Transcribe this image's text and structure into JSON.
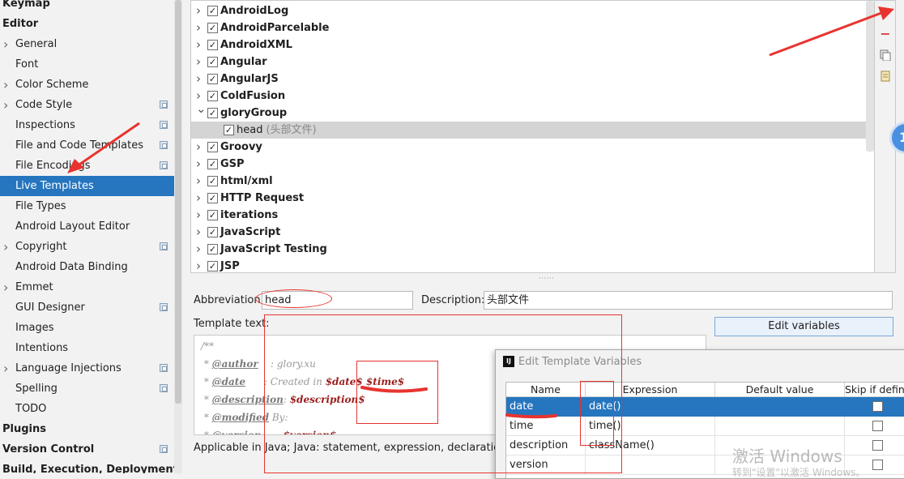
{
  "sidebar": {
    "items": [
      {
        "label": "Keymap",
        "level": 0
      },
      {
        "label": "Editor",
        "level": 0
      },
      {
        "label": "General",
        "level": 1,
        "expandable": true
      },
      {
        "label": "Font",
        "level": 1
      },
      {
        "label": "Color Scheme",
        "level": 1,
        "expandable": true
      },
      {
        "label": "Code Style",
        "level": 1,
        "expandable": true,
        "project": true
      },
      {
        "label": "Inspections",
        "level": 1,
        "project": true
      },
      {
        "label": "File and Code Templates",
        "level": 1,
        "project": true
      },
      {
        "label": "File Encodings",
        "level": 1,
        "project": true
      },
      {
        "label": "Live Templates",
        "level": 1,
        "selected": true
      },
      {
        "label": "File Types",
        "level": 1
      },
      {
        "label": "Android Layout Editor",
        "level": 1
      },
      {
        "label": "Copyright",
        "level": 1,
        "expandable": true,
        "project": true
      },
      {
        "label": "Android Data Binding",
        "level": 1
      },
      {
        "label": "Emmet",
        "level": 1,
        "expandable": true
      },
      {
        "label": "GUI Designer",
        "level": 1,
        "project": true
      },
      {
        "label": "Images",
        "level": 1
      },
      {
        "label": "Intentions",
        "level": 1
      },
      {
        "label": "Language Injections",
        "level": 1,
        "expandable": true,
        "project": true
      },
      {
        "label": "Spelling",
        "level": 1,
        "project": true
      },
      {
        "label": "TODO",
        "level": 1
      },
      {
        "label": "Plugins",
        "level": 0
      },
      {
        "label": "Version Control",
        "level": 0,
        "expandable": true,
        "project": true
      },
      {
        "label": "Build, Execution, Deployment",
        "level": 0,
        "expandable": true
      }
    ]
  },
  "templates": {
    "groups": [
      {
        "label": "AndroidLog",
        "checked": true,
        "expanded": false
      },
      {
        "label": "AndroidParcelable",
        "checked": true,
        "expanded": false
      },
      {
        "label": "AndroidXML",
        "checked": true,
        "expanded": false
      },
      {
        "label": "Angular",
        "checked": true,
        "expanded": false
      },
      {
        "label": "AngularJS",
        "checked": true,
        "expanded": false
      },
      {
        "label": "ColdFusion",
        "checked": true,
        "expanded": false
      },
      {
        "label": "gloryGroup",
        "checked": true,
        "expanded": true
      },
      {
        "label": "head",
        "checked": true,
        "child": true,
        "selected": true,
        "desc": "(头部文件)"
      },
      {
        "label": "Groovy",
        "checked": true,
        "expanded": false
      },
      {
        "label": "GSP",
        "checked": true,
        "expanded": false
      },
      {
        "label": "html/xml",
        "checked": true,
        "expanded": false
      },
      {
        "label": "HTTP Request",
        "checked": true,
        "expanded": false
      },
      {
        "label": "iterations",
        "checked": true,
        "expanded": false
      },
      {
        "label": "JavaScript",
        "checked": true,
        "expanded": false
      },
      {
        "label": "JavaScript Testing",
        "checked": true,
        "expanded": false
      },
      {
        "label": "JSP",
        "checked": true,
        "expanded": false
      }
    ],
    "toolbar": {
      "add_icon": "plus-icon",
      "remove_icon": "minus-icon",
      "copy_icon": "copy-icon",
      "restore_icon": "restore-icon"
    },
    "notification_badge": "1"
  },
  "form": {
    "abbreviation_label": "Abbreviation:",
    "abbreviation_value": "head",
    "description_label": "Description:",
    "description_value": "头部文件",
    "template_text_label": "Template text:",
    "edit_variables_button": "Edit variables",
    "template_lines": [
      {
        "prefix": "/**",
        "tag": "",
        "mid": "",
        "var": ""
      },
      {
        "prefix": " * ",
        "tag": "@author",
        "mid": "    : glory.xu",
        "var": ""
      },
      {
        "prefix": " * ",
        "tag": "@date",
        "mid": "      : Created in ",
        "var": "$date$ $time$"
      },
      {
        "prefix": " * ",
        "tag": "@description",
        "mid": ": ",
        "var": "$description$"
      },
      {
        "prefix": " * ",
        "tag": "@modified",
        "mid": " By:",
        "var": ""
      },
      {
        "prefix": " * ",
        "tag": "@version",
        "mid": ":      ",
        "var": "$version$"
      }
    ],
    "applicable_text": "Applicable in Java; Java: statement, expression, declaration, comment"
  },
  "dialog": {
    "title": "Edit Template Variables",
    "columns": [
      "Name",
      "Expression",
      "Default value",
      "Skip if defin..."
    ],
    "rows": [
      {
        "name": "date",
        "expression": "date()",
        "default": "",
        "skip": false,
        "selected": true
      },
      {
        "name": "time",
        "expression": "time()",
        "default": "",
        "skip": false
      },
      {
        "name": "description",
        "expression": "className()",
        "default": "",
        "skip": false
      },
      {
        "name": "version",
        "expression": "",
        "default": "",
        "skip": false
      }
    ]
  },
  "watermark": {
    "line1": "激活 Windows",
    "line2": "转到\"设置\"以激活 Windows。"
  },
  "colors": {
    "selection": "#2675bf",
    "annotation": "#e8342f",
    "template_var": "#9b1c1c"
  }
}
